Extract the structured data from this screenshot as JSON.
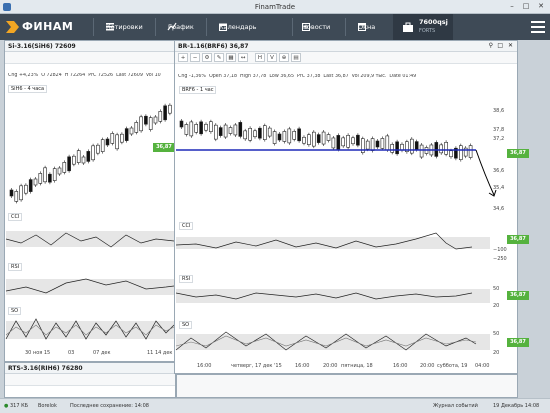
{
  "window": {
    "title": "FinamTrade"
  },
  "header": {
    "logo_text": "ФИНАМ",
    "nav": [
      {
        "label": "Котировки",
        "icon": "list-icon"
      },
      {
        "label": "График",
        "icon": "chart-icon"
      },
      {
        "label": "Календарь",
        "icon": "calendar-icon"
      },
      {
        "label": "Новости",
        "icon": "news-icon"
      },
      {
        "label": "Окна",
        "icon": "windows-icon"
      }
    ],
    "account": {
      "number": "7600qsj",
      "market": "FORTS"
    }
  },
  "left_chart": {
    "title": "Si-3.16(SiH6) 72609",
    "stats": [
      "Chg +4,23%",
      "O 72824",
      "H 72264",
      "PrC 72526",
      "Last 72609",
      "Vol 10"
    ],
    "legend": "SiH6 - 4 часа",
    "last_price": "36,87",
    "indicators": [
      "CCI",
      "RSI",
      "SO"
    ],
    "x_labels": [
      "30 ноя 15",
      "03",
      "07 дек",
      "11 14 дек"
    ],
    "bottom_title": "RTS-3.16(RIH6) 76280"
  },
  "right_chart": {
    "title": "BR-1.16(BRF6) 36,87",
    "stats": [
      "Chg -1,36%",
      "Open 37,18",
      "High 37,78",
      "Low 36,65",
      "PrC 37,38",
      "Last 36,87",
      "Vol 209,9 тыс.",
      "Date 01:49"
    ],
    "legend": "BRF6 - 1 час",
    "price_labels": [
      "38,6",
      "37,8",
      "37,2",
      "36,6",
      "35,4",
      "34,6"
    ],
    "last_price": "36,87",
    "indicators": [
      {
        "name": "CCI",
        "value": "36,87",
        "scale": [
          "−100",
          "−250"
        ]
      },
      {
        "name": "RSI",
        "value": "36,87",
        "scale": [
          "50",
          "20"
        ]
      },
      {
        "name": "SO",
        "value": "36,87",
        "scale": [
          "50",
          "20"
        ]
      }
    ],
    "x_labels": [
      "16:00",
      "четверг, 17 дек '15",
      "16:00",
      "20:00",
      "пятница, 18",
      "16:00",
      "20:00",
      "суббота, 19",
      "04:00"
    ]
  },
  "toolbar": {
    "buttons": [
      "+",
      "−",
      "⚙",
      "✎",
      "▦",
      "↔",
      "H",
      "V",
      "⊕",
      "▤"
    ]
  },
  "statusbar": {
    "traffic": "317 КБ",
    "server": "Borelok",
    "saved": "Последнее сохранение: 14:08",
    "journal": "Журнал событий",
    "datetime": "19 Декабрь 14:08"
  },
  "colors": {
    "accent_green": "#55b23e",
    "support_line": "#1f2ab8",
    "topbar": "#3e4a56"
  }
}
